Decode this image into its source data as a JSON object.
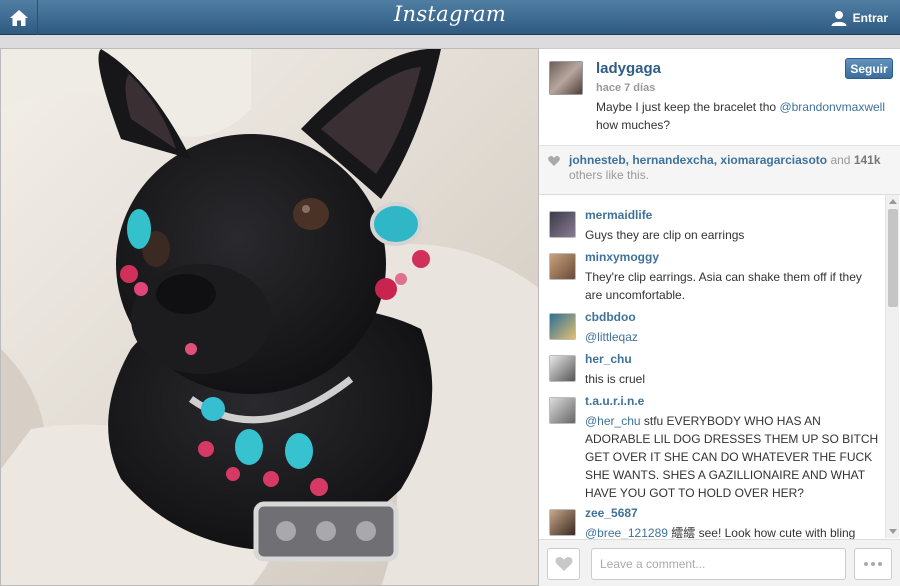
{
  "nav": {
    "brand": "Instagram",
    "login_label": "Entrar"
  },
  "post": {
    "author": "ladygaga",
    "time": "hace 7 días",
    "caption_text": "Maybe I just keep the bracelet tho",
    "caption_mention": "@brandonvmaxwell",
    "caption_line2": "how muches?",
    "follow_label": "Seguir"
  },
  "likes": {
    "users": [
      "johnesteb",
      "hernandexcha",
      "xiomaragarciasoto"
    ],
    "sep": ", ",
    "and_text": " and ",
    "count": "141k",
    "suffix": " others like this."
  },
  "comments": [
    {
      "user": "mermaidlife",
      "text": "Guys they are clip on earrings",
      "mention": ""
    },
    {
      "user": "minxymoggy",
      "text": "They're clip earrings. Asia can shake them off if they are uncomfortable.",
      "mention": ""
    },
    {
      "user": "cbdbdoo",
      "text": "",
      "mention": "@littleqaz"
    },
    {
      "user": "her_chu",
      "text": "this is cruel",
      "mention": ""
    },
    {
      "user": "t.a.u.r.i.n.e",
      "text": " stfu EVERYBODY WHO HAS AN ADORABLE LIL DOG DRESSES THEM UP SO BITCH GET OVER IT SHE CAN DO WHATEVER THE FUCK SHE WANTS. SHES A GAZILLIONAIRE AND WHAT HAVE YOU GOT TO HOLD OVER HER?",
      "mention": "@her_chu"
    },
    {
      "user": "zee_5687",
      "text": " 繧繧 see! Look how cute with bling bling.",
      "mention": "@bree_121289"
    }
  ],
  "footer": {
    "comment_placeholder": "Leave a comment..."
  },
  "colors": {
    "nav_blue": "#2f5a82",
    "link_blue": "#3f729b",
    "follow_blue": "#3a6e9c"
  },
  "icons": [
    "home-icon",
    "user-icon",
    "heart-icon",
    "more-icon"
  ]
}
